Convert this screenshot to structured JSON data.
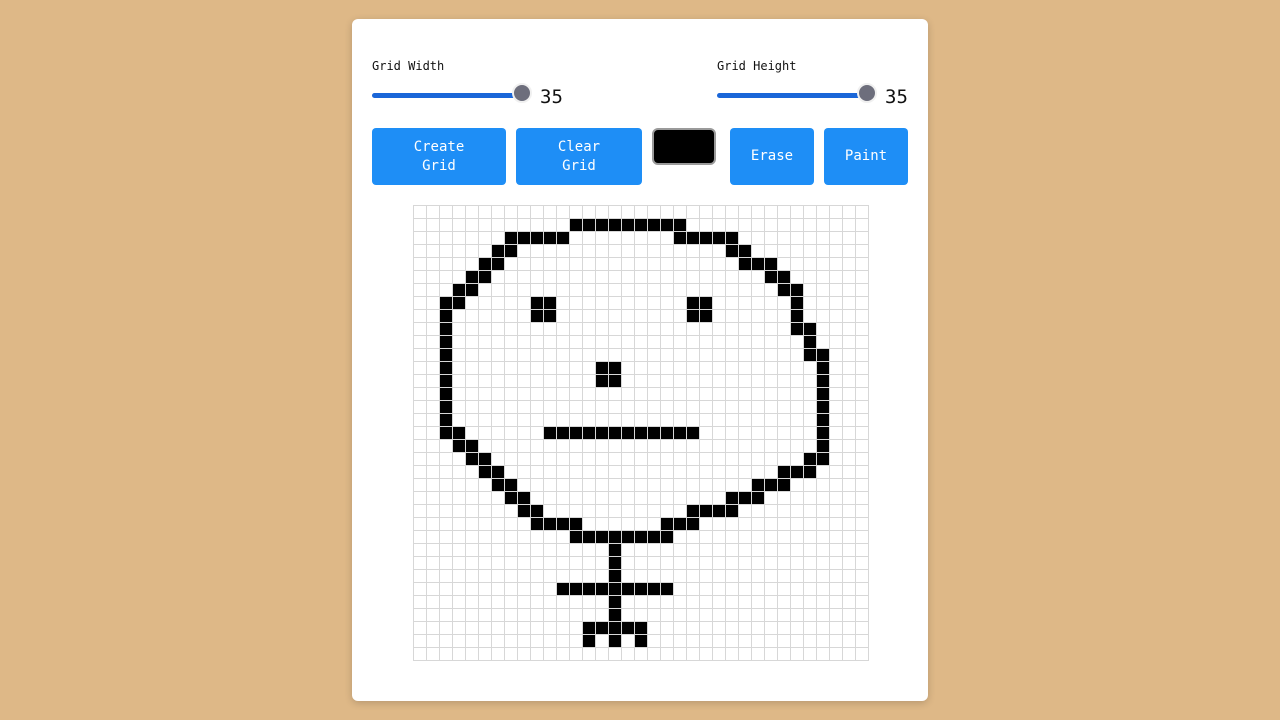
{
  "controls": {
    "width_label": "Grid Width",
    "width_value": "35",
    "width_fraction": 1.0,
    "height_label": "Grid Height",
    "height_value": "35",
    "height_fraction": 1.0
  },
  "toolbar": {
    "create_label": "Create\nGrid",
    "clear_label": "Clear\nGrid",
    "erase_label": "Erase",
    "paint_label": "Paint",
    "current_color": "#000000"
  },
  "colors": {
    "background": "#deb887",
    "button": "#1e8ef6",
    "slider_track": "#1a66d8",
    "filled_cell": "#000000",
    "empty_cell": "#ffffff",
    "grid_line": "#d7d7d7"
  },
  "grid": {
    "columns": 35,
    "rows": 35,
    "filled_cells": [
      [
        1,
        12
      ],
      [
        1,
        13
      ],
      [
        1,
        14
      ],
      [
        1,
        15
      ],
      [
        1,
        16
      ],
      [
        1,
        17
      ],
      [
        1,
        18
      ],
      [
        1,
        19
      ],
      [
        1,
        20
      ],
      [
        2,
        7
      ],
      [
        2,
        8
      ],
      [
        2,
        9
      ],
      [
        2,
        10
      ],
      [
        2,
        11
      ],
      [
        2,
        20
      ],
      [
        2,
        21
      ],
      [
        2,
        22
      ],
      [
        2,
        23
      ],
      [
        2,
        24
      ],
      [
        3,
        6
      ],
      [
        3,
        7
      ],
      [
        3,
        24
      ],
      [
        3,
        25
      ],
      [
        4,
        5
      ],
      [
        4,
        6
      ],
      [
        4,
        25
      ],
      [
        4,
        26
      ],
      [
        4,
        27
      ],
      [
        5,
        4
      ],
      [
        5,
        5
      ],
      [
        5,
        27
      ],
      [
        5,
        28
      ],
      [
        6,
        3
      ],
      [
        6,
        4
      ],
      [
        6,
        28
      ],
      [
        6,
        29
      ],
      [
        7,
        2
      ],
      [
        7,
        3
      ],
      [
        7,
        9
      ],
      [
        7,
        10
      ],
      [
        7,
        21
      ],
      [
        7,
        22
      ],
      [
        7,
        29
      ],
      [
        8,
        2
      ],
      [
        8,
        9
      ],
      [
        8,
        10
      ],
      [
        8,
        21
      ],
      [
        8,
        22
      ],
      [
        8,
        29
      ],
      [
        9,
        2
      ],
      [
        9,
        29
      ],
      [
        9,
        30
      ],
      [
        10,
        2
      ],
      [
        10,
        30
      ],
      [
        11,
        2
      ],
      [
        11,
        30
      ],
      [
        11,
        31
      ],
      [
        12,
        2
      ],
      [
        12,
        14
      ],
      [
        12,
        15
      ],
      [
        12,
        31
      ],
      [
        13,
        2
      ],
      [
        13,
        14
      ],
      [
        13,
        15
      ],
      [
        13,
        31
      ],
      [
        14,
        2
      ],
      [
        14,
        31
      ],
      [
        15,
        2
      ],
      [
        15,
        31
      ],
      [
        16,
        2
      ],
      [
        16,
        31
      ],
      [
        17,
        2
      ],
      [
        17,
        3
      ],
      [
        17,
        10
      ],
      [
        17,
        11
      ],
      [
        17,
        12
      ],
      [
        17,
        13
      ],
      [
        17,
        14
      ],
      [
        17,
        15
      ],
      [
        17,
        16
      ],
      [
        17,
        17
      ],
      [
        17,
        18
      ],
      [
        17,
        19
      ],
      [
        17,
        20
      ],
      [
        17,
        21
      ],
      [
        17,
        31
      ],
      [
        18,
        3
      ],
      [
        18,
        4
      ],
      [
        18,
        31
      ],
      [
        19,
        4
      ],
      [
        19,
        5
      ],
      [
        19,
        30
      ],
      [
        19,
        31
      ],
      [
        20,
        5
      ],
      [
        20,
        6
      ],
      [
        20,
        28
      ],
      [
        20,
        29
      ],
      [
        20,
        30
      ],
      [
        21,
        6
      ],
      [
        21,
        7
      ],
      [
        21,
        26
      ],
      [
        21,
        27
      ],
      [
        21,
        28
      ],
      [
        22,
        7
      ],
      [
        22,
        8
      ],
      [
        22,
        24
      ],
      [
        22,
        25
      ],
      [
        22,
        26
      ],
      [
        23,
        8
      ],
      [
        23,
        9
      ],
      [
        23,
        21
      ],
      [
        23,
        22
      ],
      [
        23,
        23
      ],
      [
        23,
        24
      ],
      [
        24,
        9
      ],
      [
        24,
        10
      ],
      [
        24,
        11
      ],
      [
        24,
        12
      ],
      [
        24,
        19
      ],
      [
        24,
        20
      ],
      [
        24,
        21
      ],
      [
        25,
        12
      ],
      [
        25,
        13
      ],
      [
        25,
        14
      ],
      [
        25,
        15
      ],
      [
        25,
        16
      ],
      [
        25,
        17
      ],
      [
        25,
        18
      ],
      [
        25,
        19
      ],
      [
        26,
        15
      ],
      [
        27,
        15
      ],
      [
        28,
        15
      ],
      [
        29,
        11
      ],
      [
        29,
        12
      ],
      [
        29,
        13
      ],
      [
        29,
        14
      ],
      [
        29,
        15
      ],
      [
        29,
        16
      ],
      [
        29,
        17
      ],
      [
        29,
        18
      ],
      [
        29,
        19
      ],
      [
        30,
        15
      ],
      [
        31,
        15
      ],
      [
        32,
        13
      ],
      [
        32,
        14
      ],
      [
        32,
        15
      ],
      [
        32,
        16
      ],
      [
        32,
        17
      ],
      [
        33,
        13
      ],
      [
        33,
        15
      ],
      [
        33,
        17
      ]
    ]
  }
}
